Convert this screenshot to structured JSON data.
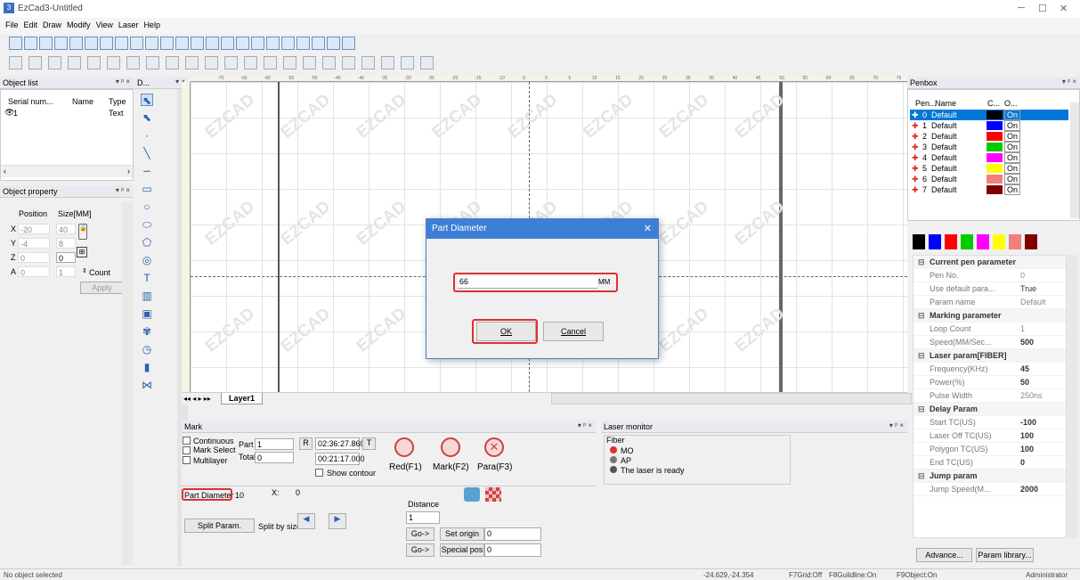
{
  "app": {
    "title": "EzCad3-Untitled",
    "icon": "app-icon"
  },
  "menu": [
    "File",
    "Edit",
    "Draw",
    "Modify",
    "View",
    "Laser",
    "Help"
  ],
  "object_list": {
    "header": "Object list",
    "columns": [
      "Serial num...",
      "Name",
      "Type"
    ],
    "row": {
      "serial": "1",
      "type": "Text"
    }
  },
  "object_property": {
    "header": "Object property",
    "position": "Position",
    "size": "Size[MM]",
    "x_label": "X",
    "x_pos": "-20",
    "x_size": "40",
    "y_label": "Y",
    "y_pos": "-4",
    "y_size": "8",
    "z_label": "Z",
    "z_pos": "0",
    "z_size": "0",
    "a_label": "A",
    "a_pos": "0",
    "a_size": "1",
    "count": "Count",
    "apply": "Apply"
  },
  "draw_panel": {
    "header": "D..."
  },
  "canvas": {
    "watermark": "EZCAD",
    "layer_tab": "Layer1",
    "ruler_labels": [
      "-70",
      "-65",
      "-60",
      "-55",
      "-50",
      "-45",
      "-40",
      "-35",
      "-30",
      "-25",
      "-20",
      "-15",
      "-10",
      "-5",
      "0",
      "5",
      "10",
      "15",
      "20",
      "25",
      "30",
      "35",
      "40",
      "45",
      "50",
      "55",
      "60",
      "65",
      "70",
      "75"
    ]
  },
  "dialog": {
    "title": "Part Diameter",
    "value": "66",
    "unit": "MM",
    "ok": "OK",
    "cancel": "Cancel"
  },
  "penbox": {
    "header": "Penbox",
    "columns": [
      "Pen...",
      "Name",
      "C...",
      "O..."
    ],
    "pens": [
      {
        "no": "0",
        "name": "Default",
        "color": "#000000",
        "on": "On"
      },
      {
        "no": "1",
        "name": "Default",
        "color": "#0000ff",
        "on": "On"
      },
      {
        "no": "2",
        "name": "Default",
        "color": "#ff0000",
        "on": "On"
      },
      {
        "no": "3",
        "name": "Default",
        "color": "#00cc00",
        "on": "On"
      },
      {
        "no": "4",
        "name": "Default",
        "color": "#ff00ff",
        "on": "On"
      },
      {
        "no": "5",
        "name": "Default",
        "color": "#ffff00",
        "on": "On"
      },
      {
        "no": "6",
        "name": "Default",
        "color": "#f08080",
        "on": "On"
      },
      {
        "no": "7",
        "name": "Default",
        "color": "#800000",
        "on": "On"
      }
    ],
    "swatches": [
      "#000000",
      "#0000ff",
      "#ff0000",
      "#00cc00",
      "#ff00ff",
      "#ffff00",
      "#f08080",
      "#800000"
    ]
  },
  "pen_params": [
    {
      "cat": true,
      "k": "Current pen parameter"
    },
    {
      "k": "Pen No.",
      "v": "0",
      "plain": true
    },
    {
      "k": "Use default para...",
      "v": "True",
      "dark": true
    },
    {
      "k": "Param name",
      "v": "Default",
      "plain": true
    },
    {
      "cat": true,
      "k": "Marking parameter"
    },
    {
      "k": "Loop Count",
      "v": "1",
      "plain": true
    },
    {
      "k": "Speed(MM/Sec...",
      "v": "500"
    },
    {
      "cat": true,
      "k": "Laser param[FIBER]"
    },
    {
      "k": "Frequency(KHz)",
      "v": "45"
    },
    {
      "k": "Power(%)",
      "v": "50"
    },
    {
      "k": "Pulse Width",
      "v": "250ns",
      "plain": true
    },
    {
      "cat": true,
      "k": "Delay Param"
    },
    {
      "k": "Start TC(US)",
      "v": "-100"
    },
    {
      "k": "Laser Off TC(US)",
      "v": "100"
    },
    {
      "k": "Polygon TC(US)",
      "v": "100"
    },
    {
      "k": "End TC(US)",
      "v": "0"
    },
    {
      "cat": true,
      "k": "Jump param"
    },
    {
      "k": "Jump Speed(M...",
      "v": "2000"
    }
  ],
  "penbox_buttons": {
    "advance": "Advance...",
    "library": "Param library..."
  },
  "mark": {
    "header": "Mark",
    "continuous": "Continuous",
    "mark_select": "Mark Select",
    "multilayer": "Multilayer",
    "part": "Part",
    "part_val": "1",
    "total": "Total",
    "total_val": "0",
    "r": "R",
    "time1": "02:36:27.860",
    "t": "T",
    "time2": "00:21:17.000",
    "show_contour": "Show contour",
    "red": "Red(F1)",
    "markf2": "Mark(F2)",
    "para": "Para(F3)",
    "part_diameter": "Part Diameter",
    "pd_val": "10",
    "x_label": "X:",
    "x_val": "0",
    "distance": "Distance",
    "distance_val": "1",
    "split_param": "Split Param.",
    "split_by": "Split by size",
    "go1": "Go->",
    "set_origin": "Set origin",
    "origin_val": "0",
    "go2": "Go->",
    "special_pos": "Special pos",
    "special_val": "0"
  },
  "laser_monitor": {
    "header": "Laser monitor",
    "group": "Fiber",
    "mo": "MO",
    "ap": "AP",
    "ready": "The laser is ready",
    "colors": {
      "mo": "#e03030",
      "ap": "#777777",
      "ready": "#555555"
    }
  },
  "status": {
    "left": "No object selected",
    "coords": "-24.629,-24.354",
    "grid": "F7Grid:Off",
    "guideline": "F8Guildline:On",
    "object": "F9Object:On",
    "user": "Administrator"
  }
}
